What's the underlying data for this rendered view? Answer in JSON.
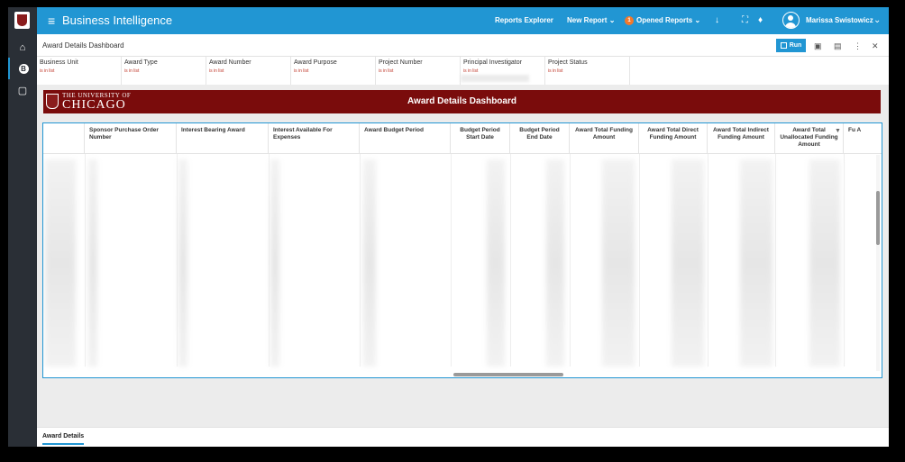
{
  "app": {
    "title": "Business Intelligence"
  },
  "topnav": {
    "reports_explorer": "Reports Explorer",
    "new_report": "New Report",
    "opened_reports": "Opened Reports",
    "opened_count": "1",
    "user_name": "Marissa Swistowicz"
  },
  "subbar": {
    "title": "Award Details Dashboard",
    "run_label": "Run"
  },
  "filters": [
    {
      "label": "Business Unit",
      "value": "is in list"
    },
    {
      "label": "Award Type",
      "value": "is in list"
    },
    {
      "label": "Award Number",
      "value": "is in list"
    },
    {
      "label": "Award Purpose",
      "value": "is in list"
    },
    {
      "label": "Project Number",
      "value": "is in list"
    },
    {
      "label": "Principal Investigator",
      "value": "is in list"
    },
    {
      "label": "Project Status",
      "value": "is in list"
    }
  ],
  "banner": {
    "university_line1": "THE UNIVERSITY OF",
    "university_line2": "CHICAGO",
    "title": "Award Details Dashboard"
  },
  "table": {
    "columns": [
      "",
      "Sponsor Purchase Order Number",
      "Interest Bearing Award",
      "Interest Available For Expenses",
      "Award Budget Period",
      "Budget Period Start Date",
      "Budget Period End Date",
      "Award Total Funding Amount",
      "Award Total Direct Funding Amount",
      "Award Total Indirect Funding Amount",
      "Award Total Unallocated Funding Amount",
      "Fu A"
    ]
  },
  "footer": {
    "tab": "Award Details"
  },
  "colors": {
    "brand_blue": "#2196d3",
    "maroon": "#7a0c0c",
    "rail": "#2a2f36"
  },
  "icons": [
    "menu-icon",
    "chevron-down-icon",
    "download-icon",
    "fullscreen-icon",
    "bell-icon",
    "home-icon",
    "dashboard-icon",
    "monitor-icon",
    "filter-icon",
    "more-icon",
    "close-icon"
  ]
}
